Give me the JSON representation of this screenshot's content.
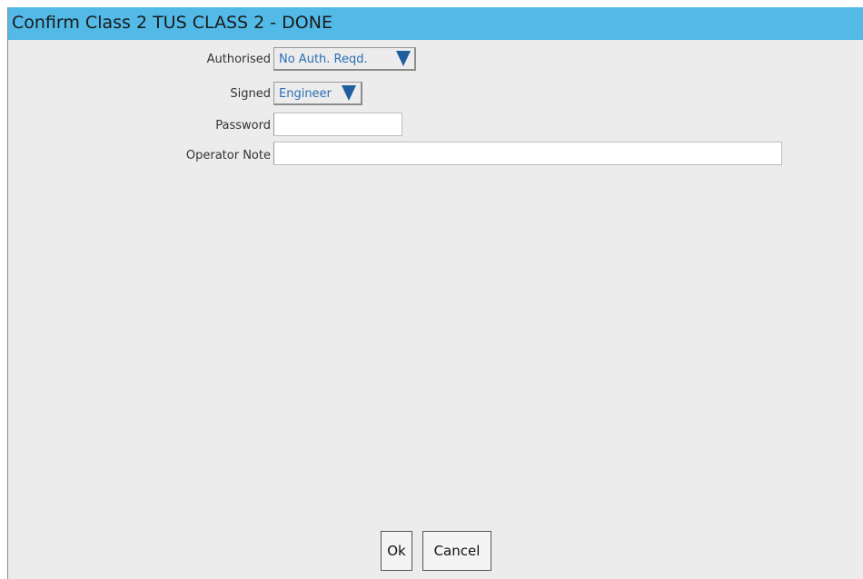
{
  "window": {
    "title": "Confirm Class 2 TUS CLASS 2 - DONE"
  },
  "form": {
    "authorised": {
      "label": "Authorised",
      "value": "No Auth. Reqd."
    },
    "signed": {
      "label": "Signed",
      "value": "Engineer"
    },
    "password": {
      "label": "Password",
      "value": ""
    },
    "operator_note": {
      "label": "Operator Note",
      "value": ""
    }
  },
  "buttons": {
    "ok": "Ok",
    "cancel": "Cancel"
  },
  "colors": {
    "titlebar": "#53b9e6",
    "panel": "#ececec",
    "dropdown_value_text": "#2a6fb5",
    "dropdown_arrow": "#1f5e9e"
  },
  "icons": {
    "dropdown": "triangle-down-icon"
  }
}
